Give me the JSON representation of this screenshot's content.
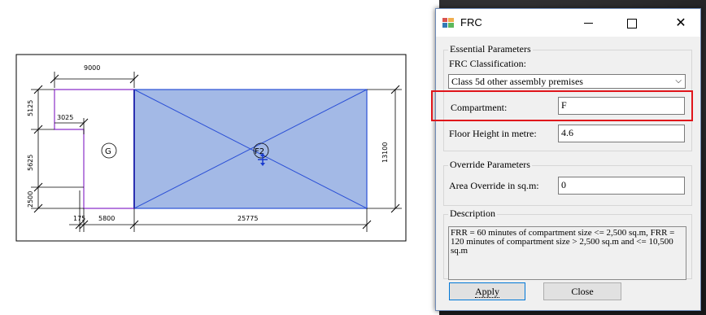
{
  "drawing": {
    "dims": {
      "top_width": "9000",
      "left_top": "5125",
      "left_mid": "5625",
      "left_bottom": "2500",
      "inner_step": "3025",
      "right_height": "13100",
      "bottom_small": "175",
      "bottom_mid": "5800",
      "bottom_long": "25775"
    },
    "room_tags": {
      "g": "G",
      "f2": "F2"
    },
    "fill_color": "#a3b9e6",
    "line_blue": "#2a4fd6",
    "line_purple": "#8b2fc9"
  },
  "dialog": {
    "title": "FRC",
    "close_glyph": "✕",
    "essential_group": "Essential Parameters",
    "classification_label": "FRC Classification:",
    "classification_value": "Class 5d other assembly premises",
    "combo_arrow": "⌵",
    "compartment_label": "Compartment:",
    "compartment_value": "F",
    "floor_height_label": "Floor Height in metre:",
    "floor_height_value": "4.6",
    "override_group": "Override Parameters",
    "area_override_label": "Area Override in sq.m:",
    "area_override_value": "0",
    "description_group": "Description",
    "description_text": "FRR = 60 minutes of compartment size <= 2,500 sq.m, FRR = 120 minutes of compartment size > 2,500 sq.m and <= 10,500 sq.m",
    "apply_label": "Apply",
    "close_label": "Close",
    "highlight_color": "#e0151b"
  }
}
